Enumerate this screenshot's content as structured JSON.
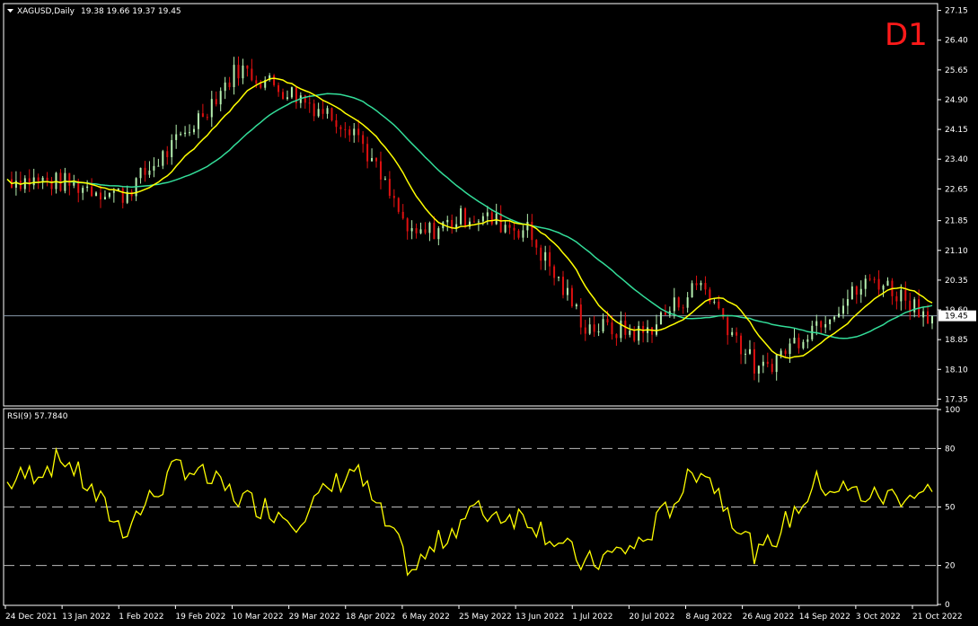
{
  "window": {
    "symbol_header": "XAGUSD,Daily",
    "ohlc_header": "19.38 19.66 19.37 19.45",
    "timeframe_badge": "D1"
  },
  "colors": {
    "background": "#000000",
    "grid_frame": "#ffffff",
    "bull_candle": "#b6f0b0",
    "bear_candle": "#e01010",
    "ma_fast": "#ffff00",
    "ma_slow": "#33dd99",
    "rsi_line": "#ffff00",
    "price_line": "#8899aa",
    "timeframe_badge": "#ff1a1a"
  },
  "price_axis": {
    "ticks": [
      "27.15",
      "26.40",
      "25.65",
      "24.90",
      "24.15",
      "23.40",
      "22.65",
      "21.85",
      "21.10",
      "20.35",
      "19.60",
      "18.85",
      "18.10",
      "17.35"
    ],
    "current_price": "19.45"
  },
  "rsi_panel": {
    "title": "RSI(9) 57.7840",
    "ticks": [
      "100",
      "80",
      "50",
      "20",
      "0"
    ],
    "levels": [
      80,
      50,
      20
    ]
  },
  "time_axis": {
    "labels": [
      "24 Dec 2021",
      "13 Jan 2022",
      "1 Feb 2022",
      "19 Feb 2022",
      "10 Mar 2022",
      "29 Mar 2022",
      "18 Apr 2022",
      "6 May 2022",
      "25 May 2022",
      "13 Jun 2022",
      "1 Jul 2022",
      "20 Jul 2022",
      "8 Aug 2022",
      "26 Aug 2022",
      "14 Sep 2022",
      "3 Oct 2022",
      "21 Oct 2022"
    ]
  },
  "chart_data": {
    "type": "line",
    "title": "XAGUSD,Daily",
    "y_range": [
      17.2,
      27.3
    ],
    "x": [
      "24 Dec 2021",
      "13 Jan 2022",
      "1 Feb 2022",
      "19 Feb 2022",
      "10 Mar 2022",
      "29 Mar 2022",
      "18 Apr 2022",
      "6 May 2022",
      "25 May 2022",
      "13 Jun 2022",
      "1 Jul 2022",
      "20 Jul 2022",
      "8 Aug 2022",
      "26 Aug 2022",
      "14 Sep 2022",
      "3 Oct 2022",
      "21 Oct 2022"
    ],
    "series": [
      {
        "name": "Close",
        "values": [
          22.9,
          22.8,
          22.5,
          23.9,
          25.7,
          25.0,
          24.2,
          21.4,
          22.0,
          21.6,
          19.2,
          19.0,
          20.3,
          18.0,
          19.3,
          20.4,
          19.45
        ]
      },
      {
        "name": "RSI(9)",
        "values": [
          62,
          75,
          38,
          72,
          55,
          44,
          70,
          17,
          48,
          45,
          20,
          32,
          72,
          24,
          62,
          55,
          57.8
        ]
      }
    ]
  }
}
